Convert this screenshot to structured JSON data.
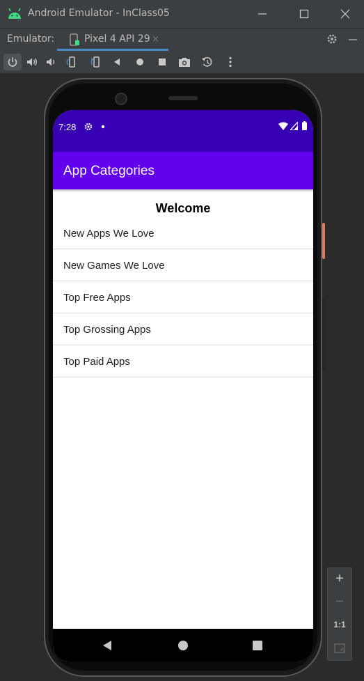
{
  "window": {
    "title": "Android Emulator - InClass05",
    "accent_color": "#3ddc84"
  },
  "tabbar": {
    "label": "Emulator:",
    "device_tab": "Pixel 4 API 29",
    "close_symbol": "×"
  },
  "toolbar": {
    "icons": [
      "power-icon",
      "volume-up-icon",
      "volume-down-icon",
      "rotate-left-icon",
      "rotate-right-icon",
      "back-icon",
      "home-icon",
      "overview-icon",
      "screenshot-icon",
      "snapshot-icon",
      "more-icon"
    ]
  },
  "phone": {
    "status_bar": {
      "time": "7:28",
      "color": "#3700b3"
    },
    "app_bar": {
      "title": "App Categories",
      "color": "#6200ee"
    },
    "welcome": "Welcome",
    "categories": [
      "New Apps We Love",
      "New Games We Love",
      "Top Free Apps",
      "Top Grossing Apps",
      "Top Paid Apps"
    ]
  },
  "zoom_panel": {
    "zoom_in": "+",
    "zoom_out": "−",
    "actual_size": "1:1"
  }
}
